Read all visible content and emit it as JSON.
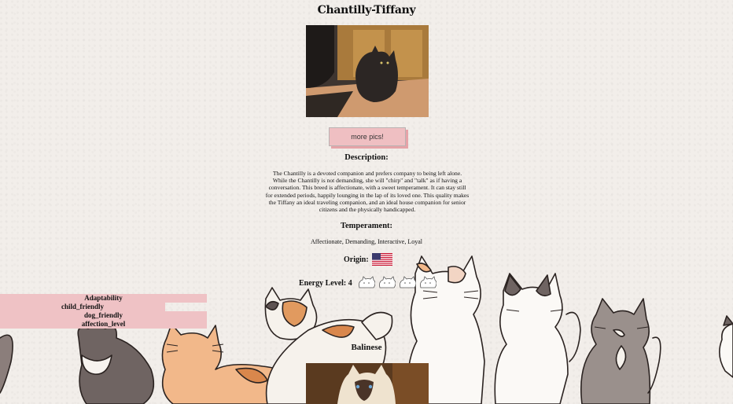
{
  "breed": {
    "name": "Chantilly-Tiffany",
    "more_pics_label": "more pics!",
    "description_label": "Description:",
    "description": "The Chantilly is a devoted companion and prefers company to being left alone. While the Chantilly is not demanding, she will \"chirp\" and \"talk\" as if having a conversation. This breed is affectionate, with a sweet temperament. It can stay still for extended periods, happily lounging in the lap of its loved one. This quality makes the Tiffany an ideal traveling companion, and an ideal house companion for senior citizens and the physically handicapped.",
    "temperament_label": "Temperament:",
    "temperament": "Affectionate, Demanding, Interactive, Loyal",
    "origin_label": "Origin:",
    "origin_flag": "us-flag-icon",
    "energy_label": "Energy Level: 4",
    "energy_level": 4,
    "energy_icon": "cat-icon"
  },
  "stats": [
    {
      "label": "Adaptability",
      "value": 5,
      "fill": 1.0
    },
    {
      "label": "child_friendly",
      "value": 4,
      "fill": 0.8
    },
    {
      "label": "dog_friendly",
      "value": 5,
      "fill": 1.0
    },
    {
      "label": "affection_level",
      "value": 5,
      "fill": 1.0
    }
  ],
  "next_breed": {
    "name": "Balinese"
  },
  "colors": {
    "background": "#f2eeea",
    "bar_pink": "#efc2c5",
    "button_pink": "#efbfc2"
  }
}
